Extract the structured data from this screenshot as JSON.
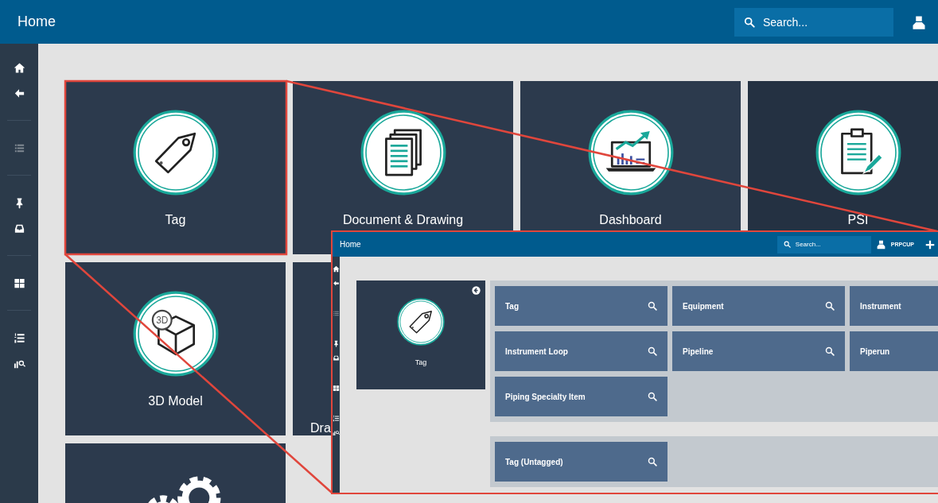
{
  "topbar": {
    "title": "Home",
    "search": {
      "placeholder": "Search..."
    }
  },
  "sidebar": {
    "items": [
      {
        "kind": "home",
        "disabled": false
      },
      {
        "kind": "back",
        "disabled": false
      },
      {
        "kind": "list",
        "disabled": true
      },
      {
        "kind": "pin",
        "disabled": false
      },
      {
        "kind": "inbox",
        "disabled": false
      },
      {
        "kind": "grid",
        "disabled": false
      },
      {
        "kind": "numlist",
        "disabled": false
      },
      {
        "kind": "chart",
        "disabled": false
      }
    ]
  },
  "tiles": [
    {
      "label": "Tag",
      "kind": "tag"
    },
    {
      "label": "Document & Drawing",
      "kind": "documents"
    },
    {
      "label": "Dashboard",
      "kind": "dashboard"
    },
    {
      "label": "PSI",
      "kind": "clipboard"
    },
    {
      "label": "3D Model",
      "kind": "cube",
      "badge": "3D"
    },
    {
      "label": "Dra",
      "kind": "none"
    },
    {
      "kind": "gears"
    }
  ],
  "inset": {
    "topbar": {
      "title": "Home",
      "search": {
        "placeholder": "Search..."
      },
      "user": "PRPCUP"
    },
    "sidebar": {
      "items": [
        {
          "kind": "home",
          "disabled": false
        },
        {
          "kind": "back",
          "disabled": false
        },
        {
          "kind": "list",
          "disabled": true
        },
        {
          "kind": "pin",
          "disabled": false
        },
        {
          "kind": "inbox",
          "disabled": false
        },
        {
          "kind": "grid",
          "disabled": false
        },
        {
          "kind": "numlist",
          "disabled": false
        },
        {
          "kind": "chart",
          "disabled": false
        }
      ]
    },
    "tile": {
      "label": "Tag",
      "kind": "tag"
    },
    "groups": [
      {
        "buttons": [
          {
            "label": "Tag",
            "search": true
          },
          {
            "label": "Equipment",
            "search": true
          },
          {
            "label": "Instrument",
            "search": false
          },
          {
            "label": "Instrument Loop",
            "search": true
          },
          {
            "label": "Pipeline",
            "search": true
          },
          {
            "label": "Piperun",
            "search": false
          },
          {
            "label": "Piping Specialty Item",
            "search": true
          }
        ]
      },
      {
        "buttons": [
          {
            "label": "Tag (Untagged)",
            "search": true
          }
        ]
      }
    ]
  }
}
